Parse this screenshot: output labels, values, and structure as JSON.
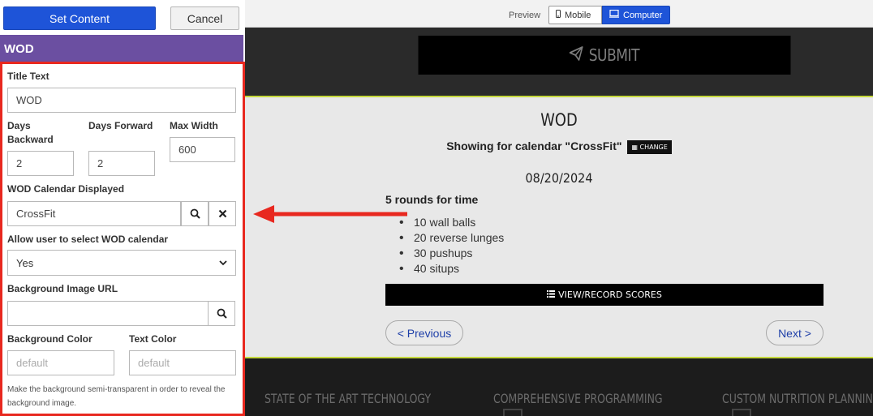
{
  "toolbar": {
    "set_content_label": "Set Content",
    "cancel_label": "Cancel"
  },
  "panel": {
    "title": "WOD",
    "title_text": {
      "label": "Title Text",
      "value": "WOD"
    },
    "days_backward": {
      "label": "Days Backward",
      "value": "2"
    },
    "days_forward": {
      "label": "Days Forward",
      "value": "2"
    },
    "max_width": {
      "label": "Max Width",
      "value": "600"
    },
    "wod_calendar": {
      "label": "WOD Calendar Displayed",
      "value": "CrossFit"
    },
    "allow_select": {
      "label": "Allow user to select WOD calendar",
      "value": "Yes"
    },
    "background_image": {
      "label": "Background Image URL",
      "value": ""
    },
    "background_color": {
      "label": "Background Color",
      "placeholder": "default"
    },
    "text_color": {
      "label": "Text Color",
      "placeholder": "default"
    },
    "help_text": "Make the background semi-transparent in order to reveal the background image."
  },
  "preview": {
    "label": "Preview",
    "mobile_label": "Mobile",
    "computer_label": "Computer",
    "selected_mode": "Computer",
    "submit_label": "SUBMIT",
    "wod_title": "WOD",
    "calendar_line": "Showing for calendar \"CrossFit\"",
    "change_label": "CHANGE",
    "date": "08/20/2024",
    "workout_title": "5 rounds for time",
    "workout_items": [
      "10 wall balls",
      "20 reverse lunges",
      "30 pushups",
      "40 situps"
    ],
    "scores_label": "VIEW/RECORD SCORES",
    "previous_label": "< Previous",
    "next_label": "Next >",
    "features": [
      "STATE OF THE ART TECHNOLOGY",
      "COMPREHENSIVE PROGRAMMING",
      "CUSTOM NUTRITION PLANNING"
    ]
  },
  "colors": {
    "primary_blue": "#1e54d8",
    "panel_header_purple": "#6b4fa1",
    "highlight_red": "#e8281f",
    "accent_lime": "#c5d83c"
  },
  "icons": {
    "submit": "paper-plane-icon",
    "change": "calendar-icon",
    "scores": "list-icon",
    "search": "search-icon",
    "clear": "close-icon",
    "mobile": "mobile-icon",
    "computer": "desktop-icon"
  }
}
